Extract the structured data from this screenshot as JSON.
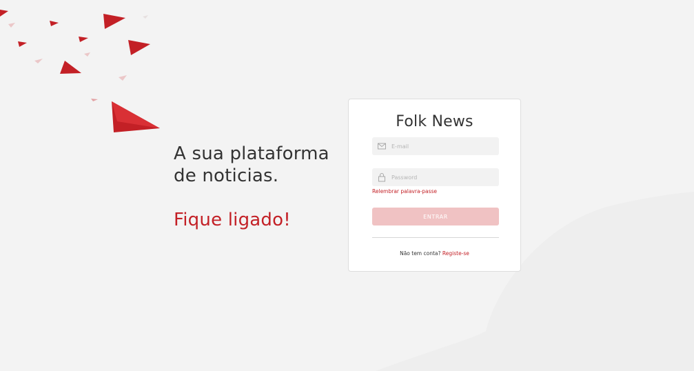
{
  "colors": {
    "accent": "#c32026",
    "button_disabled": "#f0c2c3",
    "background": "#f3f3f3"
  },
  "tagline": {
    "line1": "A sua plataforma",
    "line2": "de noticias.",
    "accent": "Fique ligado!"
  },
  "login": {
    "title": "Folk News",
    "email": {
      "placeholder": "E-mail",
      "icon": "envelope-icon"
    },
    "password": {
      "placeholder": "Password",
      "icon": "lock-icon"
    },
    "forgot_label": "Relembrar palavra-passe",
    "submit_label": "ENTRAR",
    "signup_prompt": "Não tem conta?",
    "signup_link": "Registe-se"
  },
  "decorations": {
    "icon": "paper-plane-icon"
  }
}
